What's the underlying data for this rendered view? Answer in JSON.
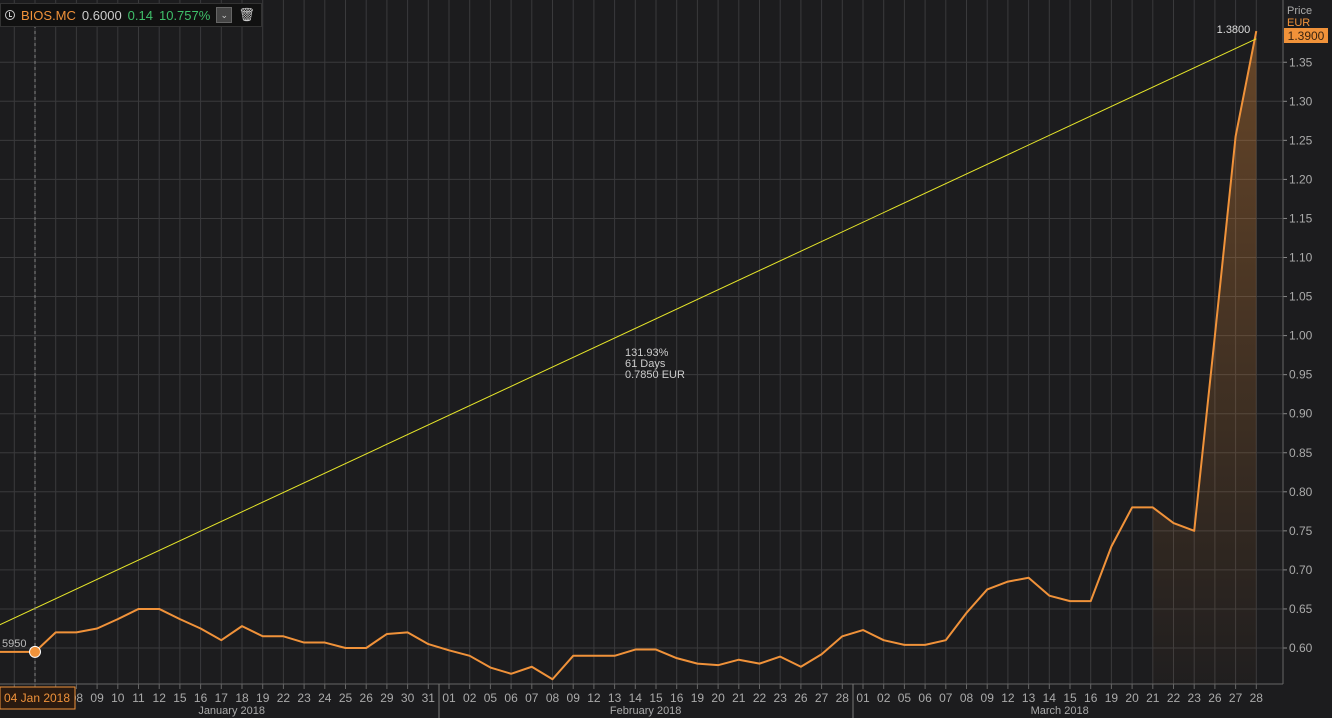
{
  "legend": {
    "symbol": "BIOS.MC",
    "last": "0.6000",
    "change": "0.14",
    "change_pct": "10.757%",
    "icon": "clock-icon",
    "dropdown_icon": "chevron-down-icon",
    "delete_icon": "trash-icon"
  },
  "axis": {
    "title": "Price",
    "currency": "EUR",
    "price_tag": "1.3900",
    "crosshair_date": "04 Jan 2018",
    "crosshair_value": "5950"
  },
  "colors": {
    "series": "#f0923a",
    "trendline": "#e6e62a",
    "background": "#1c1c1e",
    "grid": "#3a3a3c",
    "positive": "#3fbf6a"
  },
  "chart_data": {
    "type": "line",
    "title": "",
    "ylabel": "Price",
    "ylim": [
      0.545,
      1.41
    ],
    "yticks": [
      "0.60",
      "0.65",
      "0.70",
      "0.75",
      "0.80",
      "0.85",
      "0.90",
      "0.95",
      "1.00",
      "1.05",
      "1.10",
      "1.15",
      "1.20",
      "1.25",
      "1.30",
      "1.35"
    ],
    "grid": true,
    "months": [
      {
        "label": "January 2018",
        "from": 2,
        "to": 21
      },
      {
        "label": "February 2018",
        "from": 22,
        "to": 41
      },
      {
        "label": "March 2018",
        "from": 42,
        "to": 61
      }
    ],
    "categories": [
      "02",
      "03",
      "04",
      "05",
      "08",
      "09",
      "10",
      "11",
      "12",
      "15",
      "16",
      "17",
      "18",
      "19",
      "22",
      "23",
      "24",
      "25",
      "26",
      "29",
      "30",
      "31",
      "01",
      "02",
      "05",
      "06",
      "07",
      "08",
      "09",
      "12",
      "13",
      "14",
      "15",
      "16",
      "19",
      "20",
      "21",
      "22",
      "23",
      "26",
      "27",
      "28",
      "01",
      "02",
      "05",
      "06",
      "07",
      "08",
      "09",
      "12",
      "13",
      "14",
      "15",
      "16",
      "19",
      "20",
      "21",
      "22",
      "23",
      "26",
      "27",
      "28"
    ],
    "series": [
      {
        "values": [
          0.595,
          0.595,
          0.595,
          0.62,
          0.62,
          0.625,
          0.637,
          0.65,
          0.65,
          0.637,
          0.625,
          0.61,
          0.628,
          0.615,
          0.615,
          0.607,
          0.607,
          0.6,
          0.6,
          0.618,
          0.62,
          0.605,
          0.597,
          0.59,
          0.575,
          0.567,
          0.576,
          0.56,
          0.59,
          0.59,
          0.59,
          0.598,
          0.598,
          0.587,
          0.58,
          0.578,
          0.585,
          0.58,
          0.589,
          0.576,
          0.592,
          0.615,
          0.623,
          0.61,
          0.604,
          0.604,
          0.61,
          0.645,
          0.675,
          0.685,
          0.69,
          0.667,
          0.66,
          0.66,
          0.73,
          0.78,
          0.78,
          0.76,
          0.75,
          1.0,
          1.255,
          1.39
        ]
      }
    ],
    "trendline": {
      "start_index": 2,
      "start_value": 0.595,
      "end_index": 61,
      "end_value": 1.38,
      "end_label": "1.3800",
      "stats": [
        "131.93%",
        "61 Days",
        "0.7850 EUR"
      ]
    }
  }
}
